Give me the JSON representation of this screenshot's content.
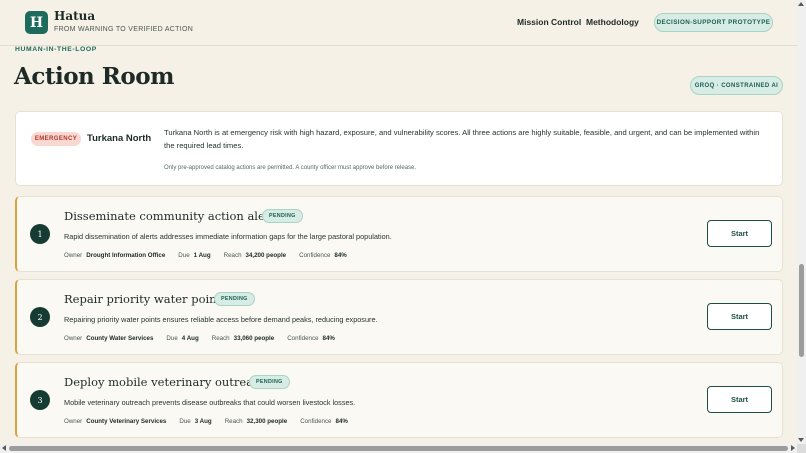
{
  "header": {
    "logo_letter": "H",
    "brand_name": "Hatua",
    "tagline": "FROM WARNING TO VERIFIED ACTION",
    "nav": [
      "Mission Control",
      "Methodology"
    ],
    "prototype_badge": "DECISION-SUPPORT PROTOTYPE"
  },
  "page": {
    "eyebrow": "HUMAN-IN-THE-LOOP",
    "title": "Action Room",
    "ai_badge": "GROQ · CONSTRAINED AI"
  },
  "summary": {
    "risk_badge": "EMERGENCY",
    "county": "Turkana North",
    "text": "Turkana North is at emergency risk with high hazard, exposure, and vulnerability scores. All three actions are highly suitable, feasible, and urgent, and can be implemented within the required lead times.",
    "note": "Only pre-approved catalog actions are permitted. A county officer must approve before release."
  },
  "meta_labels": {
    "owner": "Owner",
    "due": "Due",
    "reach": "Reach",
    "confidence": "Confidence"
  },
  "actions": [
    {
      "number": "1",
      "title": "Disseminate community action alerts",
      "status": "PENDING",
      "description": "Rapid dissemination of alerts addresses immediate information gaps for the large pastoral population.",
      "owner": "Drought Information Office",
      "due": "1 Aug",
      "reach": "34,200 people",
      "confidence": "84%",
      "button": "Start"
    },
    {
      "number": "2",
      "title": "Repair priority water points",
      "status": "PENDING",
      "description": "Repairing priority water points ensures reliable access before demand peaks, reducing exposure.",
      "owner": "County Water Services",
      "due": "4 Aug",
      "reach": "33,060 people",
      "confidence": "84%",
      "button": "Start"
    },
    {
      "number": "3",
      "title": "Deploy mobile veterinary outreach",
      "status": "PENDING",
      "description": "Mobile veterinary outreach prevents disease outbreaks that could worsen livestock losses.",
      "owner": "County Veterinary Services",
      "due": "3 Aug",
      "reach": "32,300 people",
      "confidence": "84%",
      "button": "Start"
    }
  ],
  "colors": {
    "background": "#f6f1e6",
    "brand": "#1d6b5c",
    "accent_border": "#d8a23f",
    "emergency": "#b0382a"
  },
  "icons": {
    "scroll_up": "arrow-up-icon",
    "scroll_down": "arrow-down-icon",
    "scroll_left": "arrow-left-icon",
    "scroll_right": "arrow-right-icon"
  }
}
